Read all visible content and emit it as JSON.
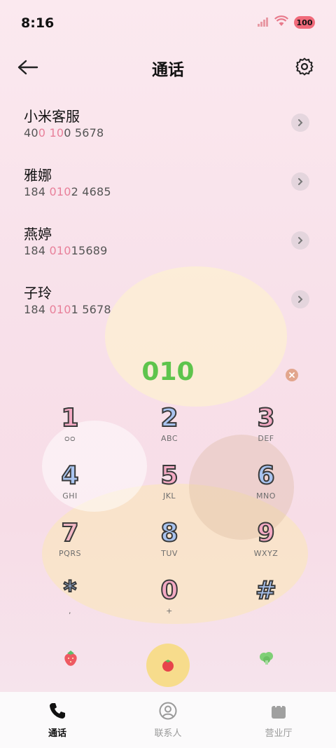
{
  "status_bar": {
    "time": "8:16",
    "battery": "100"
  },
  "header": {
    "title": "通话"
  },
  "recents": [
    {
      "name": "小米客服",
      "number_parts": [
        "40",
        "0",
        " ",
        "10",
        "0 5678"
      ]
    },
    {
      "name": "雅娜",
      "number_parts": [
        "184 ",
        "010",
        "2 4685",
        "",
        ""
      ]
    },
    {
      "name": "燕婷",
      "number_parts": [
        "184 ",
        "010",
        "15689",
        "",
        ""
      ]
    },
    {
      "name": "子玲",
      "number_parts": [
        "184 ",
        "010",
        "1 5678",
        "",
        ""
      ]
    }
  ],
  "dial_input": {
    "value": "010"
  },
  "keypad": [
    {
      "digit": "1",
      "letters": "ᴑᴑ"
    },
    {
      "digit": "2",
      "letters": "ABC"
    },
    {
      "digit": "3",
      "letters": "DEF"
    },
    {
      "digit": "4",
      "letters": "GHI"
    },
    {
      "digit": "5",
      "letters": "JKL"
    },
    {
      "digit": "6",
      "letters": "MNO"
    },
    {
      "digit": "7",
      "letters": "PQRS"
    },
    {
      "digit": "8",
      "letters": "TUV"
    },
    {
      "digit": "9",
      "letters": "WXYZ"
    },
    {
      "digit": "*",
      "letters": ","
    },
    {
      "digit": "0",
      "letters": "+"
    },
    {
      "digit": "#",
      "letters": ""
    }
  ],
  "tabs": [
    {
      "label": "通话",
      "icon": "phone-icon",
      "active": true
    },
    {
      "label": "联系人",
      "icon": "person-icon",
      "active": false
    },
    {
      "label": "营业厅",
      "icon": "shopping-bag-icon",
      "active": false
    }
  ],
  "colors": {
    "accent_green": "#5ec44c",
    "highlight_pink": "#e8809a",
    "call_button": "#f7dc8c"
  }
}
